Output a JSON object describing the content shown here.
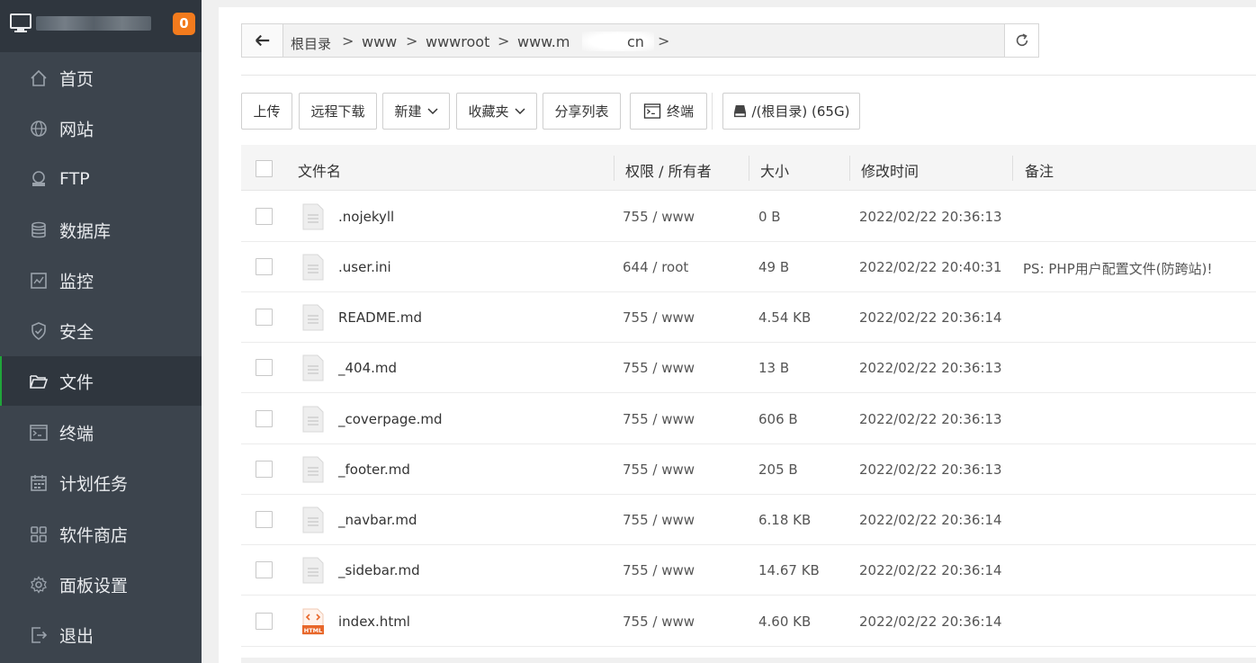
{
  "sidebar": {
    "badge": "0",
    "items": [
      {
        "label": "首页",
        "icon": "home-icon"
      },
      {
        "label": "网站",
        "icon": "globe-icon"
      },
      {
        "label": "FTP",
        "icon": "ftp-icon"
      },
      {
        "label": "数据库",
        "icon": "database-icon"
      },
      {
        "label": "监控",
        "icon": "monitor-chart-icon"
      },
      {
        "label": "安全",
        "icon": "shield-icon"
      },
      {
        "label": "文件",
        "icon": "folder-icon"
      },
      {
        "label": "终端",
        "icon": "terminal-icon"
      },
      {
        "label": "计划任务",
        "icon": "calendar-icon"
      },
      {
        "label": "软件商店",
        "icon": "grid-icon"
      },
      {
        "label": "面板设置",
        "icon": "gear-icon"
      },
      {
        "label": "退出",
        "icon": "logout-icon"
      }
    ],
    "active_index": 6
  },
  "breadcrumb": {
    "root": "根目录",
    "parts": [
      "www",
      "wwwroot",
      "www.m",
      "cn"
    ],
    "separator": ">"
  },
  "toolbar": {
    "upload": "上传",
    "remote_download": "远程下载",
    "new": "新建",
    "favorites": "收藏夹",
    "share_list": "分享列表",
    "terminal": "终端",
    "disk": "/(根目录) (65G)"
  },
  "table": {
    "headers": {
      "name": "文件名",
      "perm": "权限 / 所有者",
      "size": "大小",
      "mtime": "修改时间",
      "note": "备注"
    },
    "rows": [
      {
        "name": ".nojekyll",
        "perm": "755 / www",
        "size": "0 B",
        "mtime": "2022/02/22 20:36:13",
        "note": "",
        "type": "file"
      },
      {
        "name": ".user.ini",
        "perm": "644 / root",
        "size": "49 B",
        "mtime": "2022/02/22 20:40:31",
        "note": "PS: PHP用户配置文件(防跨站)!",
        "type": "file"
      },
      {
        "name": "README.md",
        "perm": "755 / www",
        "size": "4.54 KB",
        "mtime": "2022/02/22 20:36:14",
        "note": "",
        "type": "file"
      },
      {
        "name": "_404.md",
        "perm": "755 / www",
        "size": "13 B",
        "mtime": "2022/02/22 20:36:13",
        "note": "",
        "type": "file"
      },
      {
        "name": "_coverpage.md",
        "perm": "755 / www",
        "size": "606 B",
        "mtime": "2022/02/22 20:36:13",
        "note": "",
        "type": "file"
      },
      {
        "name": "_footer.md",
        "perm": "755 / www",
        "size": "205 B",
        "mtime": "2022/02/22 20:36:13",
        "note": "",
        "type": "file"
      },
      {
        "name": "_navbar.md",
        "perm": "755 / www",
        "size": "6.18 KB",
        "mtime": "2022/02/22 20:36:14",
        "note": "",
        "type": "file"
      },
      {
        "name": "_sidebar.md",
        "perm": "755 / www",
        "size": "14.67 KB",
        "mtime": "2022/02/22 20:36:14",
        "note": "",
        "type": "file"
      },
      {
        "name": "index.html",
        "perm": "755 / www",
        "size": "4.60 KB",
        "mtime": "2022/02/22 20:36:14",
        "note": "",
        "type": "html",
        "icon_text": "HTML"
      }
    ]
  },
  "colors": {
    "sidebar_bg": "#3c444d",
    "sidebar_top_bg": "#2f363e",
    "accent_green": "#20a53a",
    "badge_orange": "#f37b1d",
    "html_icon_orange": "#e8672a"
  }
}
